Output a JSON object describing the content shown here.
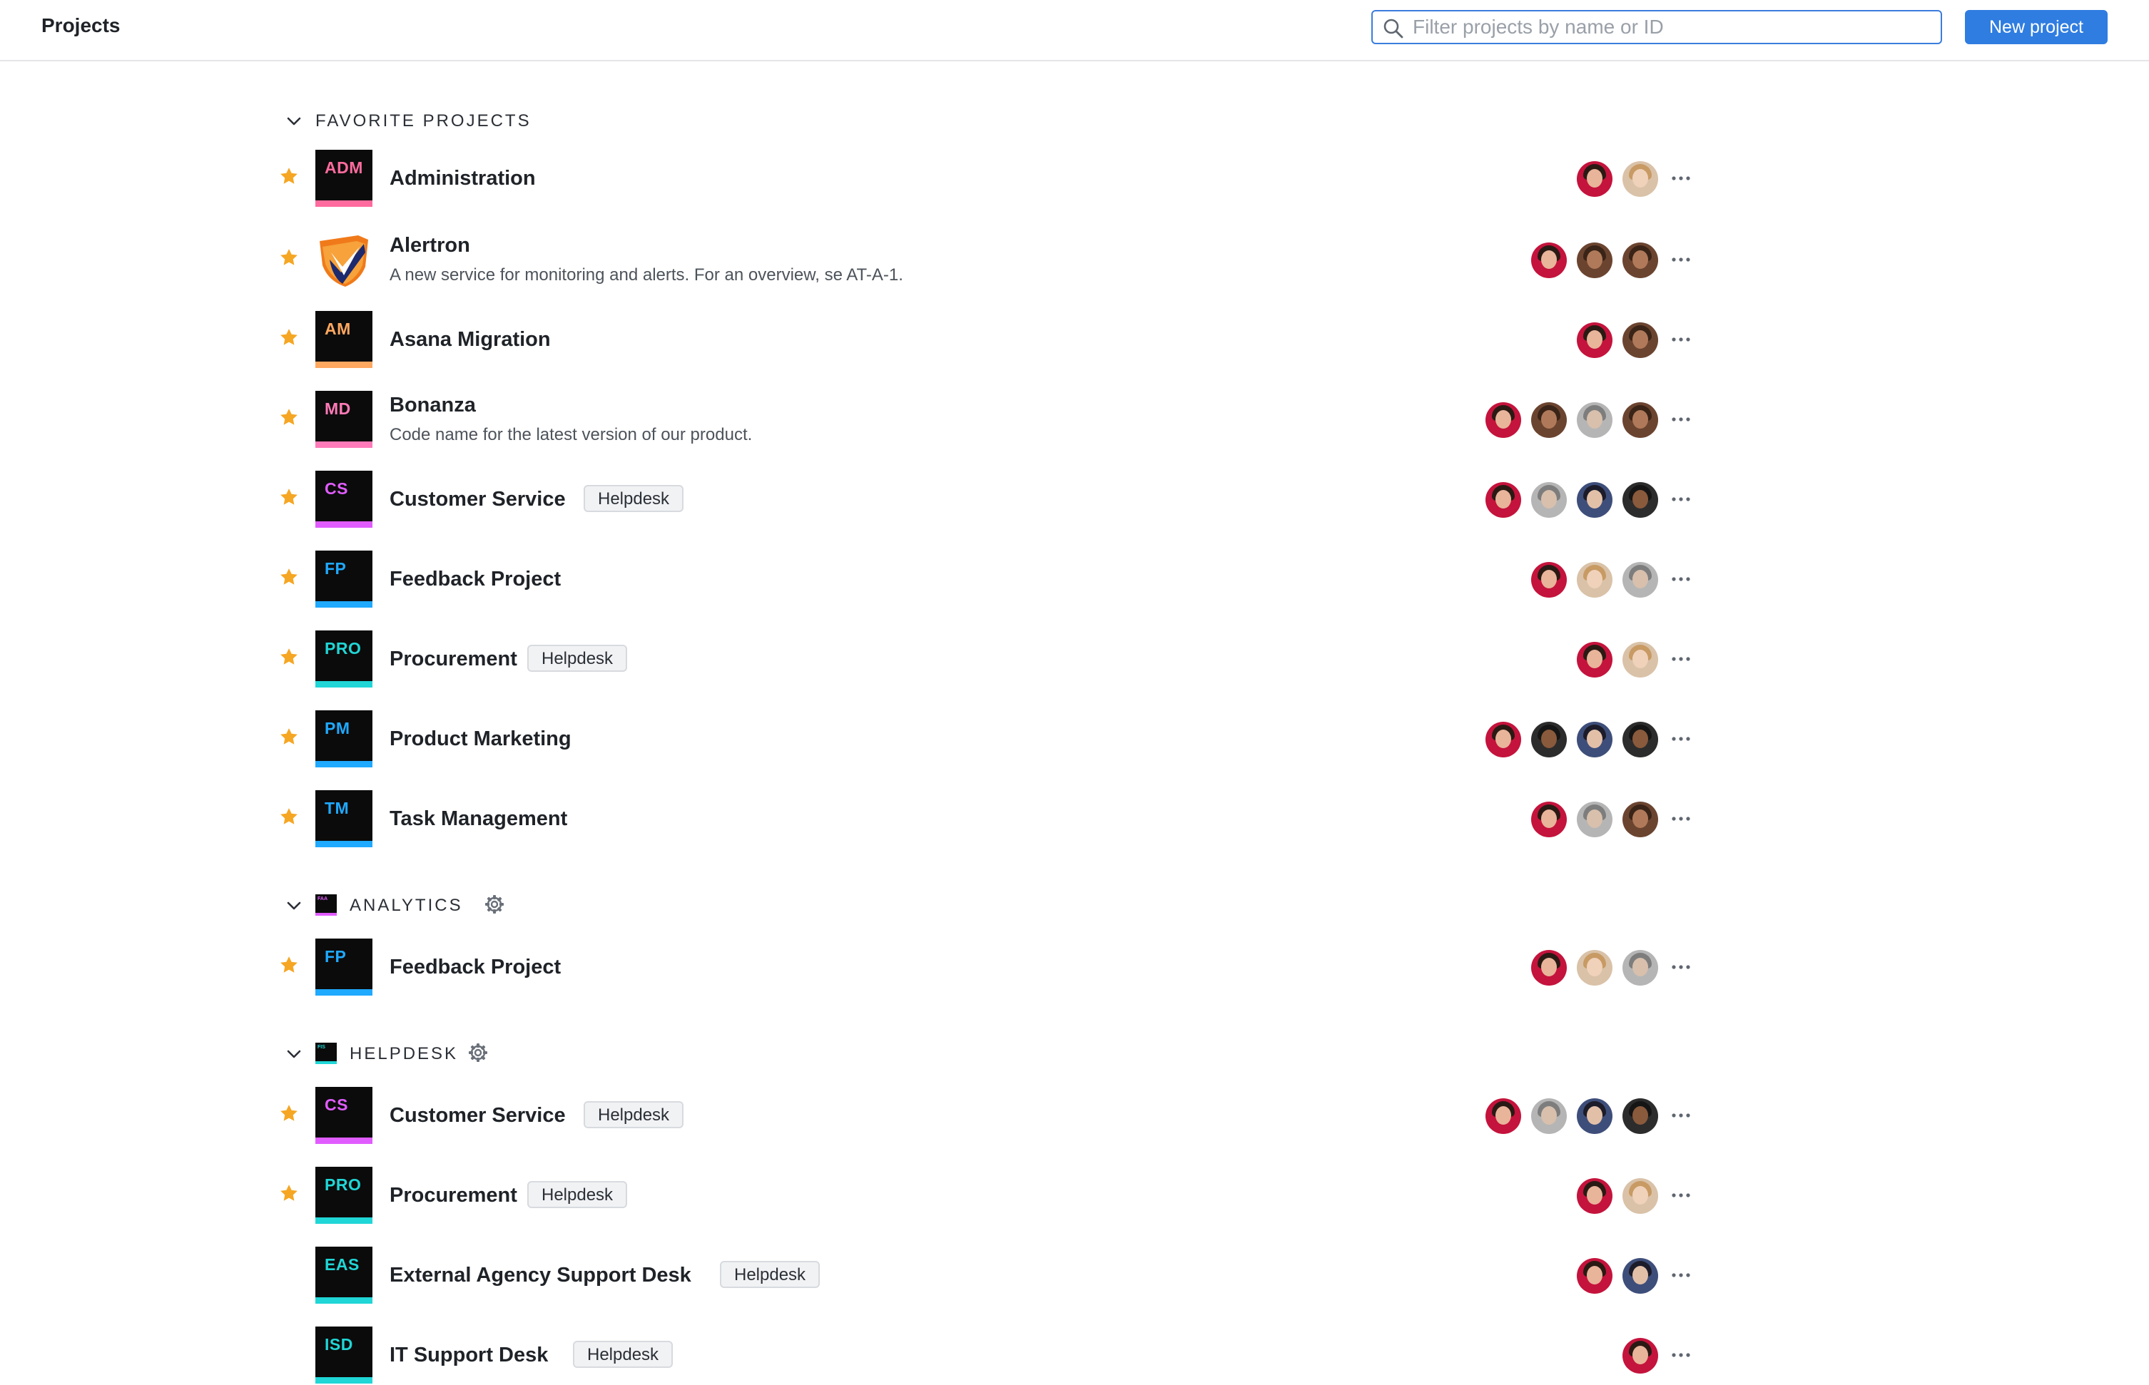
{
  "header": {
    "title": "Projects",
    "search_placeholder": "Filter projects by name or ID",
    "new_project_label": "New project"
  },
  "colors": {
    "accent": "#2f7de1",
    "star": "#f5a623",
    "avatar_red": "#c4133c",
    "avatar_beige": "#d9c2a8",
    "avatar_gray": "#b5b5b5",
    "avatar_brown": "#6b4430",
    "avatar_dark": "#2c2c2c",
    "avatar_blue": "#3e4e7a"
  },
  "sections": [
    {
      "title": "FAVORITE PROJECTS",
      "rows": [
        {
          "abbr": "ADM",
          "color": "#ff6b9e",
          "name": "Administration",
          "desc": "",
          "tag": "",
          "starred": true,
          "avatars": [
            "red",
            "beige"
          ]
        },
        {
          "abbr": "",
          "color": "",
          "logo": "shield",
          "name": "Alertron",
          "desc": "A new service for monitoring and alerts. For an overview, se AT-A-1.",
          "tag": "",
          "starred": true,
          "avatars": [
            "red",
            "brown",
            "brown"
          ]
        },
        {
          "abbr": "AM",
          "color": "#ffa860",
          "name": "Asana Migration",
          "desc": "",
          "tag": "",
          "starred": true,
          "avatars": [
            "red",
            "brown"
          ]
        },
        {
          "abbr": "MD",
          "color": "#ff7ab8",
          "name": "Bonanza",
          "desc": "Code name for the latest version of our product.",
          "tag": "",
          "starred": true,
          "avatars": [
            "red",
            "brown",
            "gray",
            "brown"
          ]
        },
        {
          "abbr": "CS",
          "color": "#e15cff",
          "name": "Customer Service",
          "desc": "",
          "tag": "Helpdesk",
          "starred": true,
          "avatars": [
            "red",
            "gray",
            "blue",
            "dark"
          ]
        },
        {
          "abbr": "FP",
          "color": "#1fa9ff",
          "name": "Feedback Project",
          "desc": "",
          "tag": "",
          "starred": true,
          "avatars": [
            "red",
            "beige",
            "gray"
          ]
        },
        {
          "abbr": "PRO",
          "color": "#20d6d6",
          "name": "Procurement",
          "desc": "",
          "tag": "Helpdesk",
          "starred": true,
          "avatars": [
            "red",
            "beige"
          ]
        },
        {
          "abbr": "PM",
          "color": "#1fa9ff",
          "name": "Product Marketing",
          "desc": "",
          "tag": "",
          "starred": true,
          "avatars": [
            "red",
            "dark",
            "blue",
            "dark"
          ]
        },
        {
          "abbr": "TM",
          "color": "#1fa9ff",
          "name": "Task Management",
          "desc": "",
          "tag": "",
          "starred": true,
          "avatars": [
            "red",
            "gray",
            "brown"
          ]
        }
      ]
    },
    {
      "title": "ANALYTICS",
      "logo_color": "#e15cff",
      "logo_text": "FAA",
      "rows": [
        {
          "abbr": "FP",
          "color": "#1fa9ff",
          "name": "Feedback Project",
          "desc": "",
          "tag": "",
          "starred": true,
          "avatars": [
            "red",
            "beige",
            "gray"
          ]
        }
      ]
    },
    {
      "title": "HELPDESK",
      "logo_color": "#20d6d6",
      "logo_text": "FIS",
      "rows": [
        {
          "abbr": "CS",
          "color": "#e15cff",
          "name": "Customer Service",
          "desc": "",
          "tag": "Helpdesk",
          "starred": true,
          "avatars": [
            "red",
            "gray",
            "blue",
            "dark"
          ]
        },
        {
          "abbr": "PRO",
          "color": "#20d6d6",
          "name": "Procurement",
          "desc": "",
          "tag": "Helpdesk",
          "starred": true,
          "avatars": [
            "red",
            "beige"
          ]
        },
        {
          "abbr": "EAS",
          "color": "#20d6d6",
          "name": "External Agency Support Desk",
          "desc": "",
          "tag": "Helpdesk",
          "starred": false,
          "avatars": [
            "red",
            "blue"
          ]
        },
        {
          "abbr": "ISD",
          "color": "#20d6d6",
          "name": "IT Support Desk",
          "desc": "",
          "tag": "Helpdesk",
          "starred": false,
          "avatars": [
            "red"
          ]
        }
      ]
    }
  ]
}
